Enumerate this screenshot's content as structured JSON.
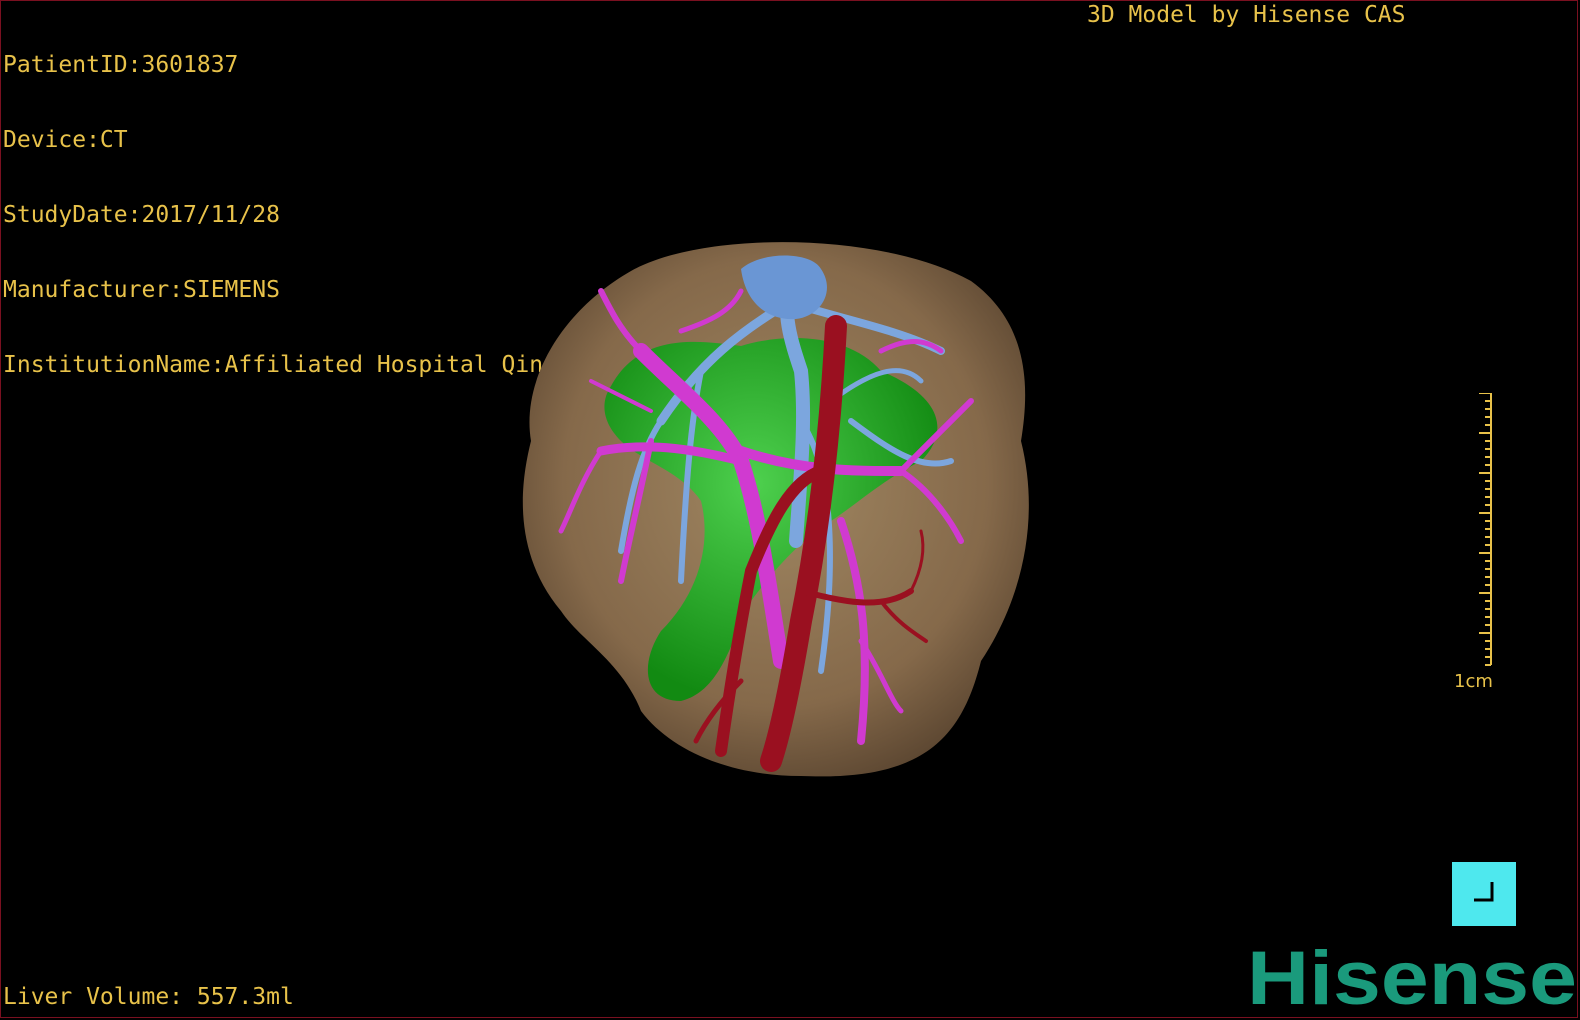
{
  "overlay": {
    "patient_id": "PatientID:3601837",
    "device": "Device:CT",
    "study_date": "StudyDate:2017/11/28",
    "manufacturer": "Manufacturer:SIEMENS",
    "institution": "InstitutionName:Affiliated Hospital Qingdao University-C",
    "credit": "3D Model by Hisense CAS",
    "liver_volume": "Liver Volume: 557.3ml"
  },
  "scale_bar": {
    "label": "1cm"
  },
  "logo": {
    "text": "Hisense",
    "color": "#1a9a7c"
  },
  "colors": {
    "overlay_text": "#e8c24a",
    "liver": "#8a7152",
    "tumor": "#1fa51f",
    "portal_vein": "#d03ad0",
    "hepatic_vein": "#7ca6de",
    "artery": "#9a1020",
    "button": "#4ee8ee"
  },
  "icons": {
    "corner_button": "resize-corner-icon"
  }
}
